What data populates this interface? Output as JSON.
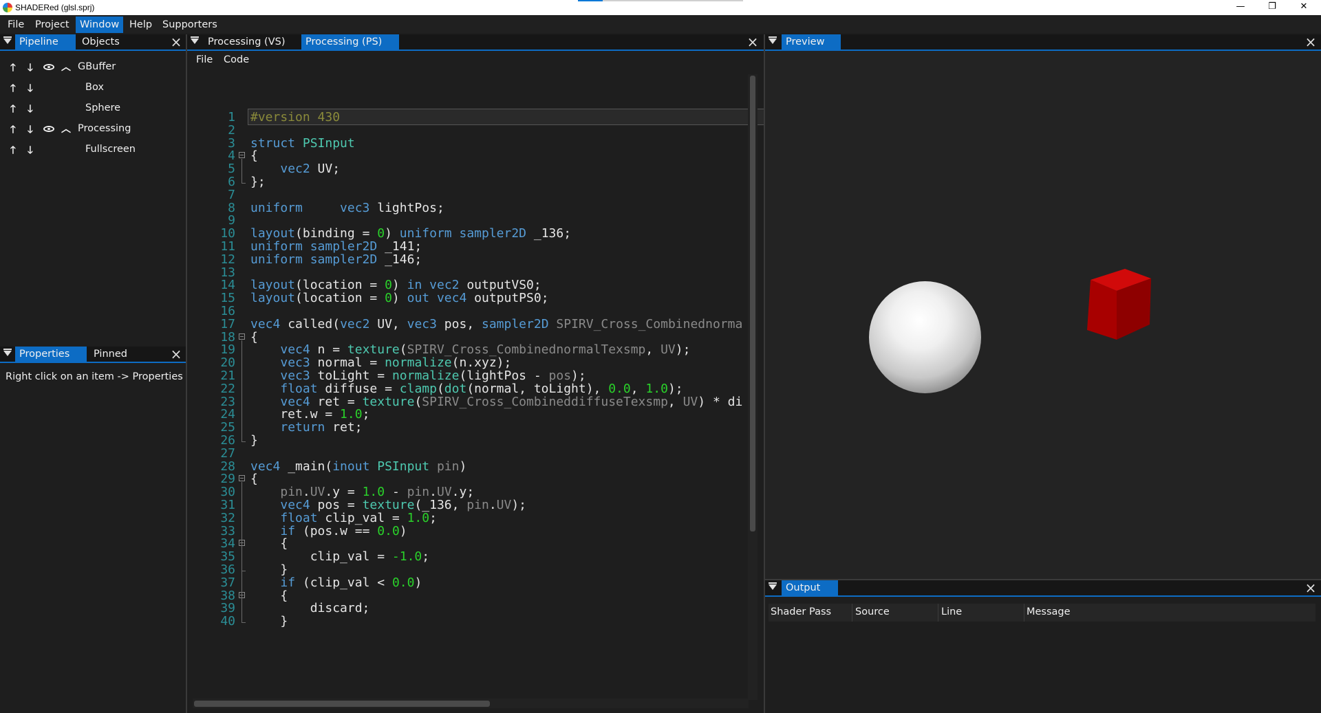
{
  "window": {
    "title": "SHADERed (glsl.sprj)",
    "minimize_glyph": "—",
    "maximize_glyph": "❐",
    "close_glyph": "✕",
    "progress_fraction": 0.15
  },
  "menu": [
    "File",
    "Project",
    "Window",
    "Help",
    "Supporters"
  ],
  "menu_active": "Window",
  "left_panel": {
    "tabs": [
      "Pipeline",
      "Objects"
    ],
    "items": [
      {
        "label": "GBuffer",
        "type": "pass"
      },
      {
        "label": "Box",
        "type": "item"
      },
      {
        "label": "Sphere",
        "type": "item"
      },
      {
        "label": "Processing",
        "type": "pass"
      },
      {
        "label": "Fullscreen",
        "type": "item"
      }
    ]
  },
  "props_panel": {
    "tabs": [
      "Properties",
      "Pinned"
    ],
    "hint": "Right click on an item -> Properties"
  },
  "editor": {
    "tabs": [
      "Processing (VS)",
      "Processing (PS)"
    ],
    "active_tab": "Processing (PS)",
    "menu": [
      "File",
      "Code"
    ],
    "line_count": 40
  },
  "preview": {
    "tab": "Preview"
  },
  "output": {
    "tab": "Output",
    "columns": [
      "Shader Pass",
      "Source",
      "Line",
      "Message"
    ]
  },
  "icons": {
    "up": "arrow-up-icon",
    "down": "arrow-down-icon",
    "eye": "eye-icon",
    "collapse": "chevron-up-icon",
    "panel_menu": "panel-menu-icon",
    "close": "close-icon"
  },
  "colors": {
    "accent": "#0d6cc4",
    "keyword": "#569cd6",
    "type": "#4ec9b0",
    "number": "#2ad12a",
    "line_number": "#2b8e96",
    "cube": "#b30000"
  }
}
